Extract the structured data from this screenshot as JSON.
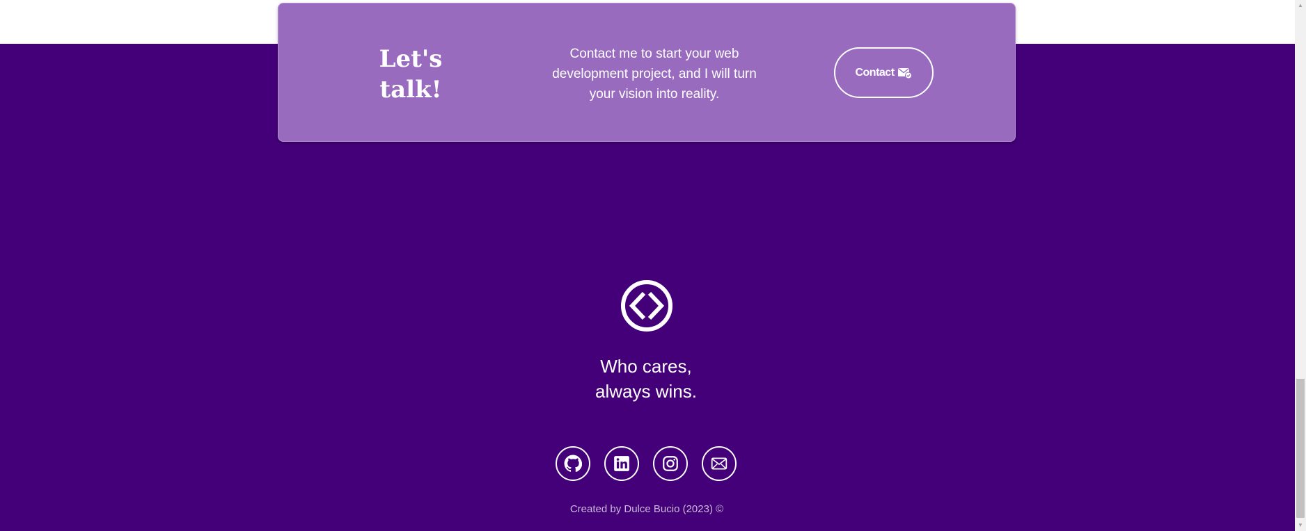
{
  "cta": {
    "title": "Let's talk!",
    "text_line1": "Contact me to start your web",
    "text_line2": "development project, and I will turn",
    "text_line3": "your vision into reality.",
    "button_label": "Contact",
    "button_icon": "mail-check-icon",
    "background": "#986bbf"
  },
  "footer": {
    "background": "#440078",
    "logo_icon": "code-brackets-icon",
    "tagline_line1": "Who cares,",
    "tagline_line2": "always wins.",
    "socials": [
      {
        "icon": "github-icon"
      },
      {
        "icon": "linkedin-icon"
      },
      {
        "icon": "instagram-icon"
      },
      {
        "icon": "mail-icon"
      }
    ],
    "credit": "Created by Dulce Bucio (2023) ©"
  }
}
